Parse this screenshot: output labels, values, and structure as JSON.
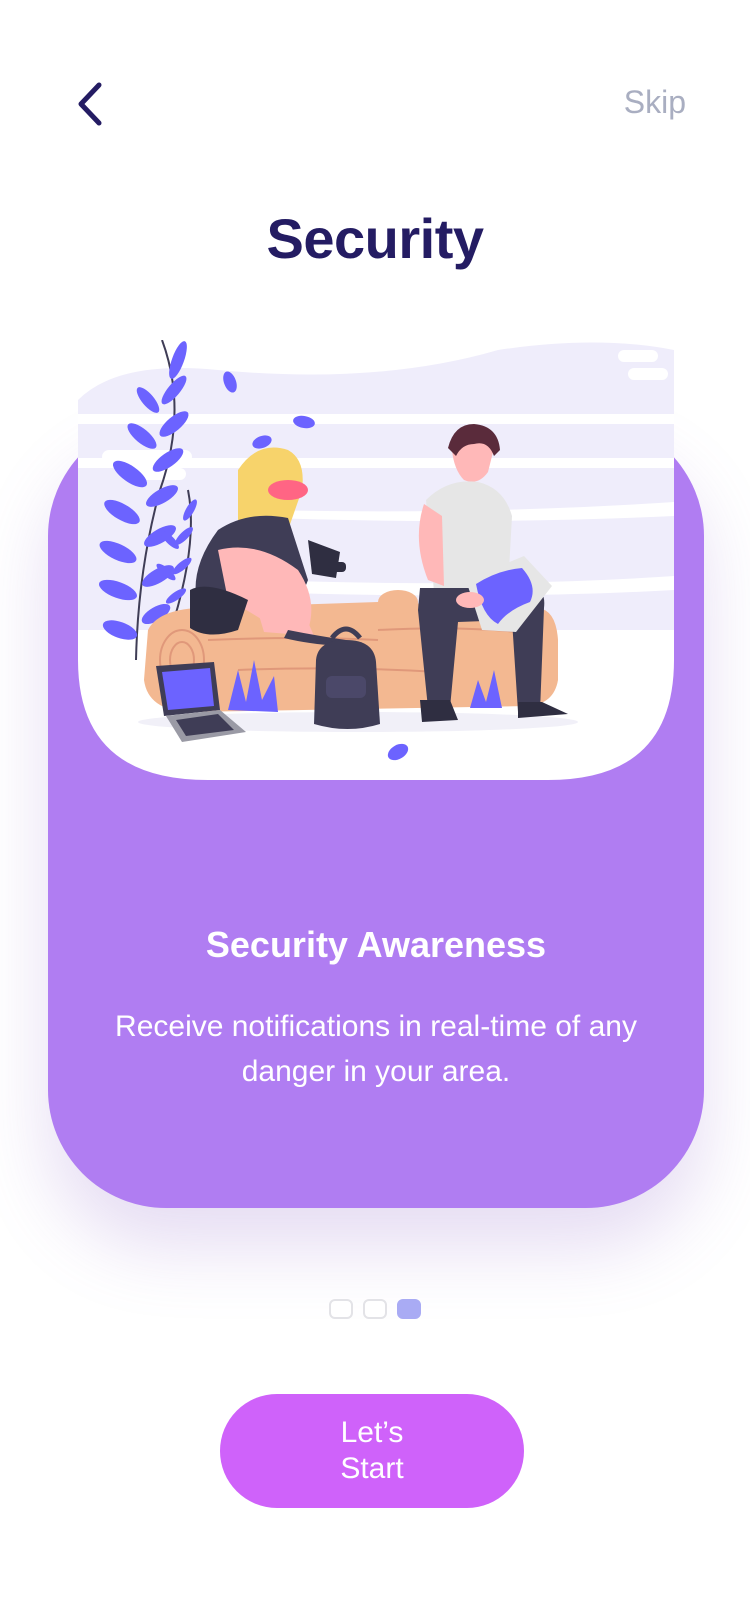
{
  "header": {
    "back_icon": "chevron-left-icon",
    "skip_label": "Skip",
    "title": "Security"
  },
  "card": {
    "title": "Security Awareness",
    "description": "Receive notifications in real-time of any danger in your area."
  },
  "pagination": {
    "count": 3,
    "active_index": 2
  },
  "cta": {
    "label": "Let’s Start"
  },
  "colors": {
    "title": "#241c63",
    "skip": "#a9aec1",
    "card": "#b07df2",
    "cta": "#cf62fa",
    "dot_active": "#a9abf4",
    "accent_illustration": "#6c63ff"
  }
}
